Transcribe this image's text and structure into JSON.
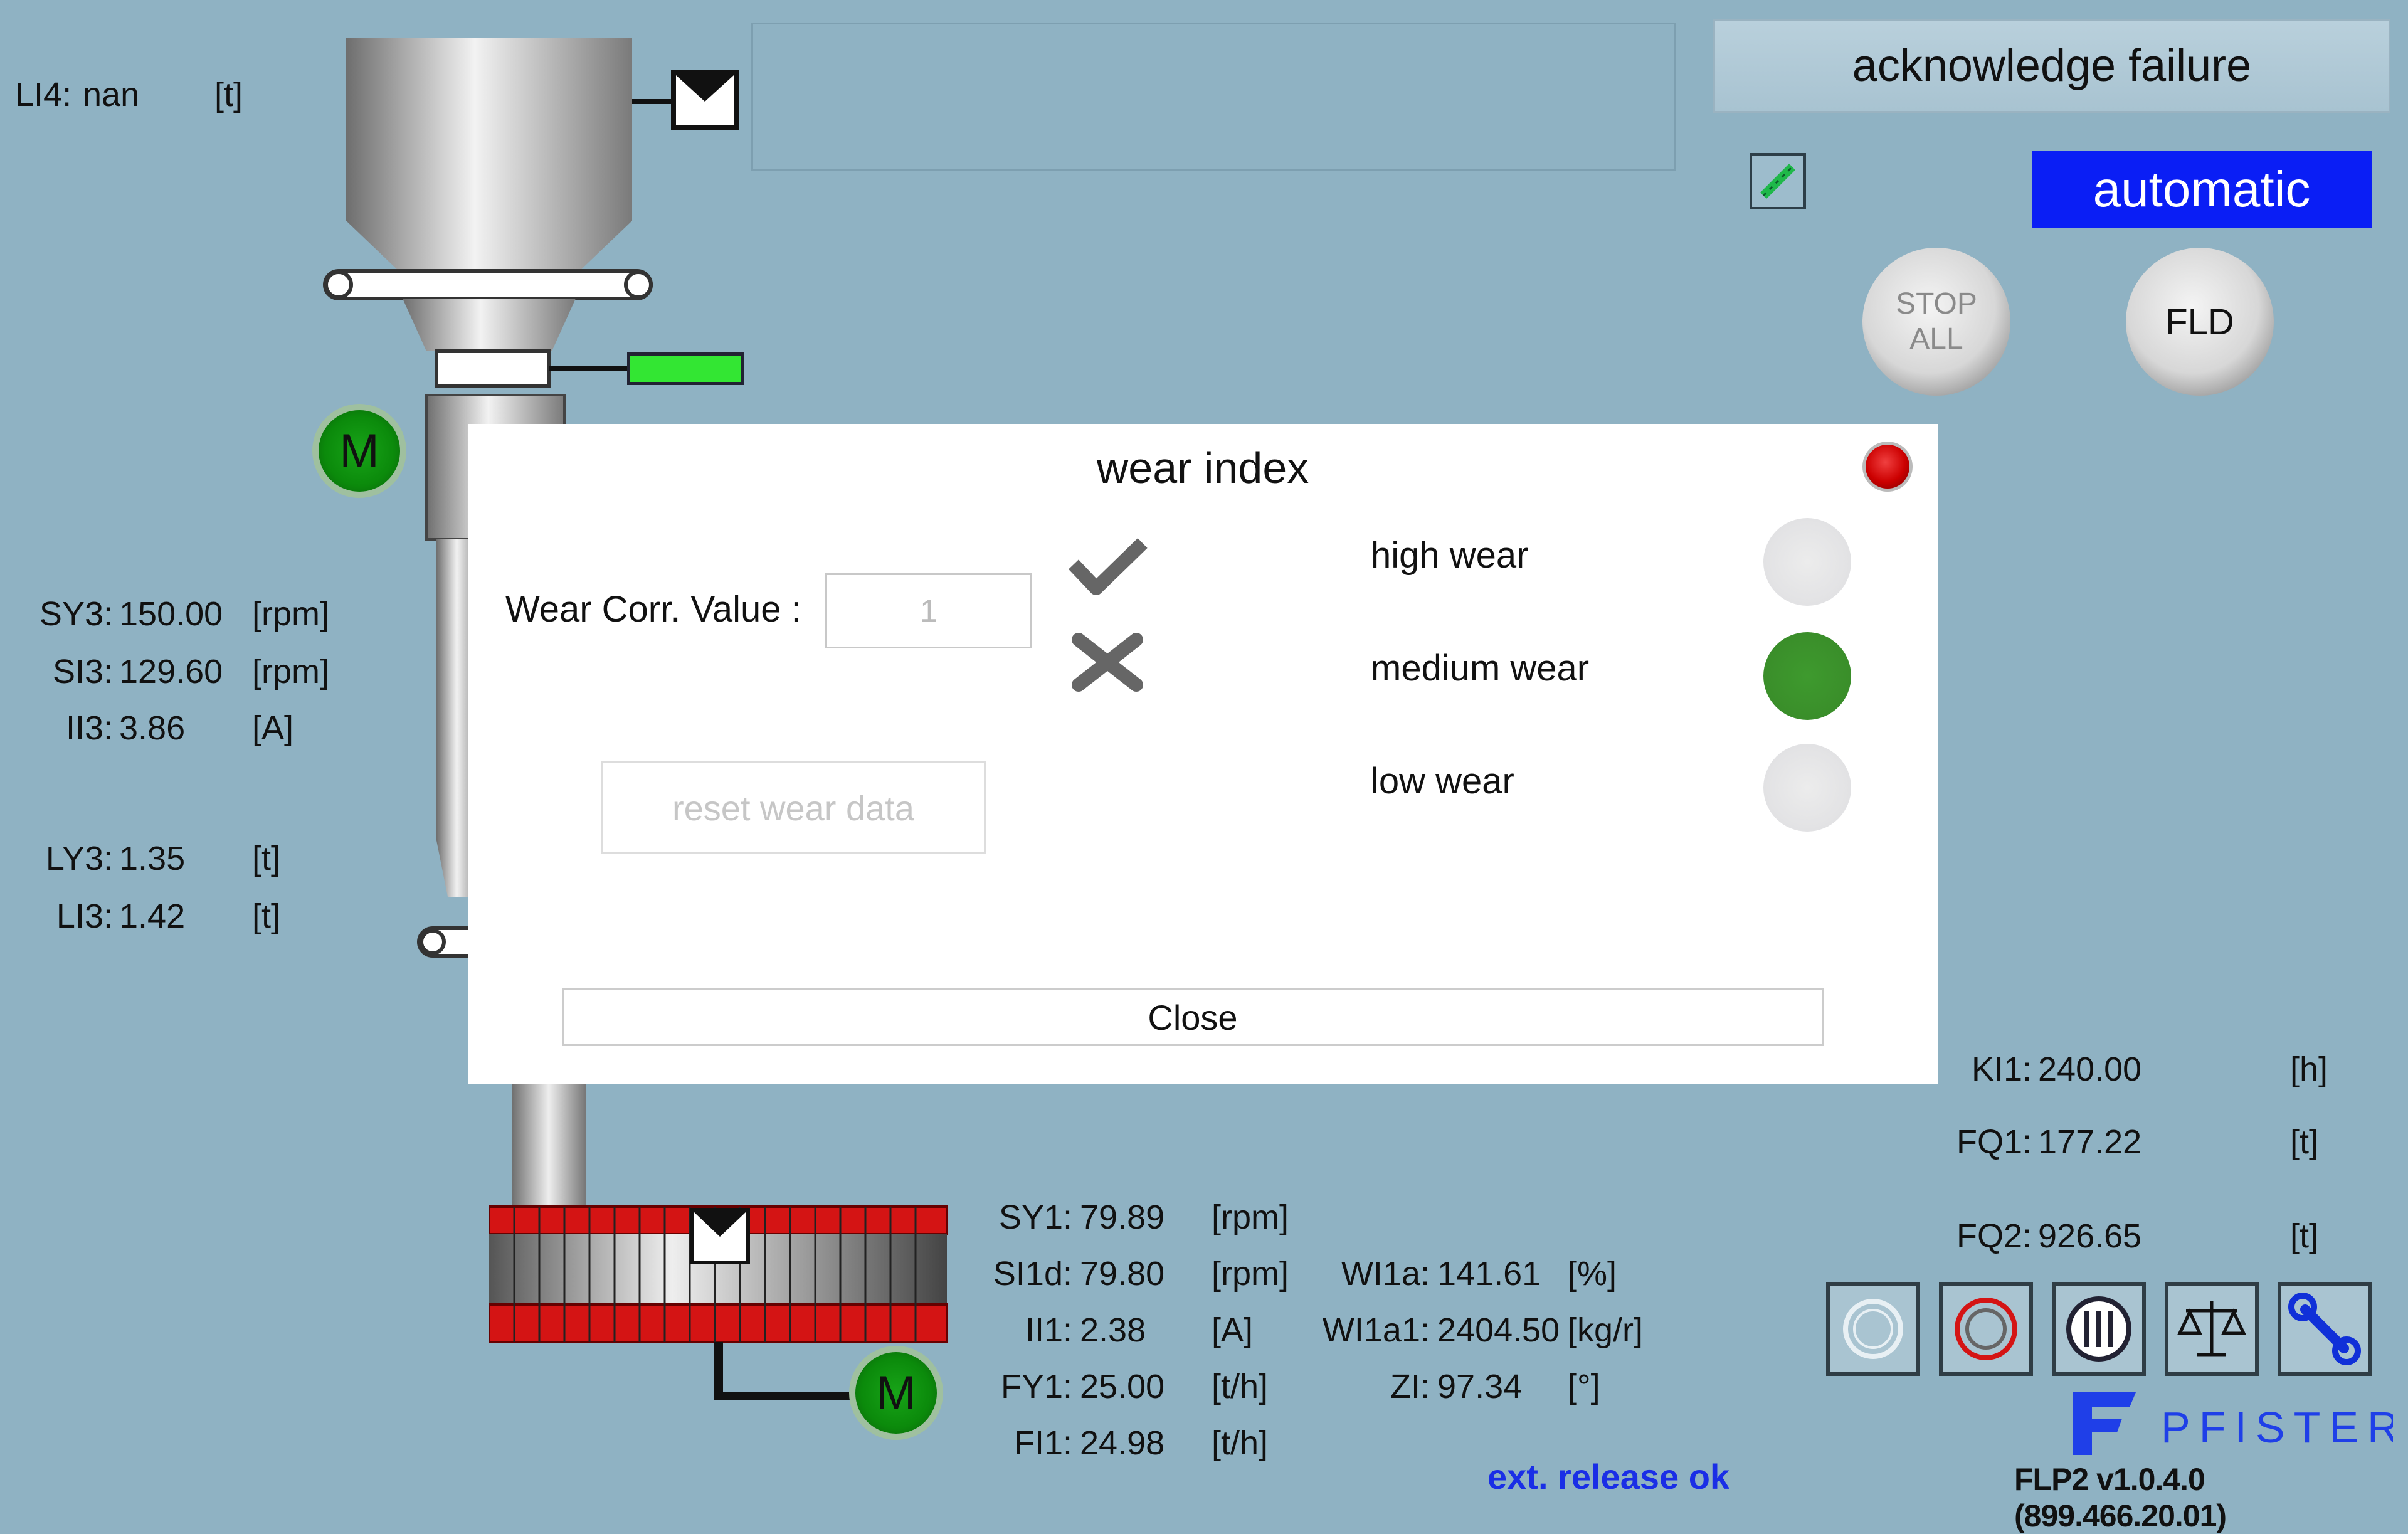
{
  "header": {
    "acknowledge_label": "acknowledge failure",
    "mode_label": "automatic",
    "stop_all_line1": "STOP",
    "stop_all_line2": "ALL",
    "fld_label": "FLD"
  },
  "left_values": {
    "li4": {
      "name": "LI4:",
      "value": "nan",
      "unit": "[t]"
    },
    "sy3": {
      "name": "SY3:",
      "value": "150.00",
      "unit": "[rpm]"
    },
    "si3": {
      "name": "SI3:",
      "value": "129.60",
      "unit": "[rpm]"
    },
    "ii3": {
      "name": "II3:",
      "value": "3.86",
      "unit": "[A]"
    },
    "ly3": {
      "name": "LY3:",
      "value": "1.35",
      "unit": "[t]"
    },
    "li3": {
      "name": "LI3:",
      "value": "1.42",
      "unit": "[t]"
    }
  },
  "bottom_values": {
    "sy1": {
      "name": "SY1:",
      "value": "79.89",
      "unit": "[rpm]"
    },
    "si1d": {
      "name": "SI1d:",
      "value": "79.80",
      "unit": "[rpm]"
    },
    "ii1": {
      "name": "II1:",
      "value": "2.38",
      "unit": "[A]"
    },
    "fy1": {
      "name": "FY1:",
      "value": "25.00",
      "unit": "[t/h]"
    },
    "fi1": {
      "name": "FI1:",
      "value": "24.98",
      "unit": "[t/h]"
    },
    "wi1a": {
      "name": "WI1a:",
      "value": "141.61",
      "unit": "[%]"
    },
    "wi1a1": {
      "name": "WI1a1:",
      "value": "2404.50",
      "unit": "[kg/r]"
    },
    "zi": {
      "name": "ZI:",
      "value": "97.34",
      "unit": "[°]"
    }
  },
  "right_values": {
    "ki1": {
      "name": "KI1:",
      "value": "240.00",
      "unit": "[h]"
    },
    "fq1": {
      "name": "FQ1:",
      "value": "177.22",
      "unit": "[t]"
    },
    "fq2": {
      "name": "FQ2:",
      "value": "926.65",
      "unit": "[t]"
    }
  },
  "motors": {
    "label": "M"
  },
  "dialog": {
    "title": "wear index",
    "field_label": "Wear Corr. Value :",
    "field_value": "1",
    "reset_label": "reset wear data",
    "wear_levels": [
      {
        "label": "high wear",
        "state": "off"
      },
      {
        "label": "medium wear",
        "state": "on"
      },
      {
        "label": "low wear",
        "state": "off"
      }
    ],
    "close_label": "Close",
    "colors": {
      "active_lamp": "#3a8e2a",
      "close_dot": "#cc0000"
    }
  },
  "toolbar": {
    "icons": [
      "speed-gauge-icon",
      "rotor-icon",
      "control-panel-icon",
      "scale-icon",
      "wrench-icon"
    ]
  },
  "status": {
    "ext_release": "ext. release ok"
  },
  "brand": {
    "name": "PFISTER",
    "version": "FLP2 v1.0.4.0 (899.466.20.01)"
  },
  "colors": {
    "background": "#8fb2c3",
    "automatic": "#0a1ef5",
    "status_blue": "#1a2ee6",
    "status_green": "#33e633"
  }
}
